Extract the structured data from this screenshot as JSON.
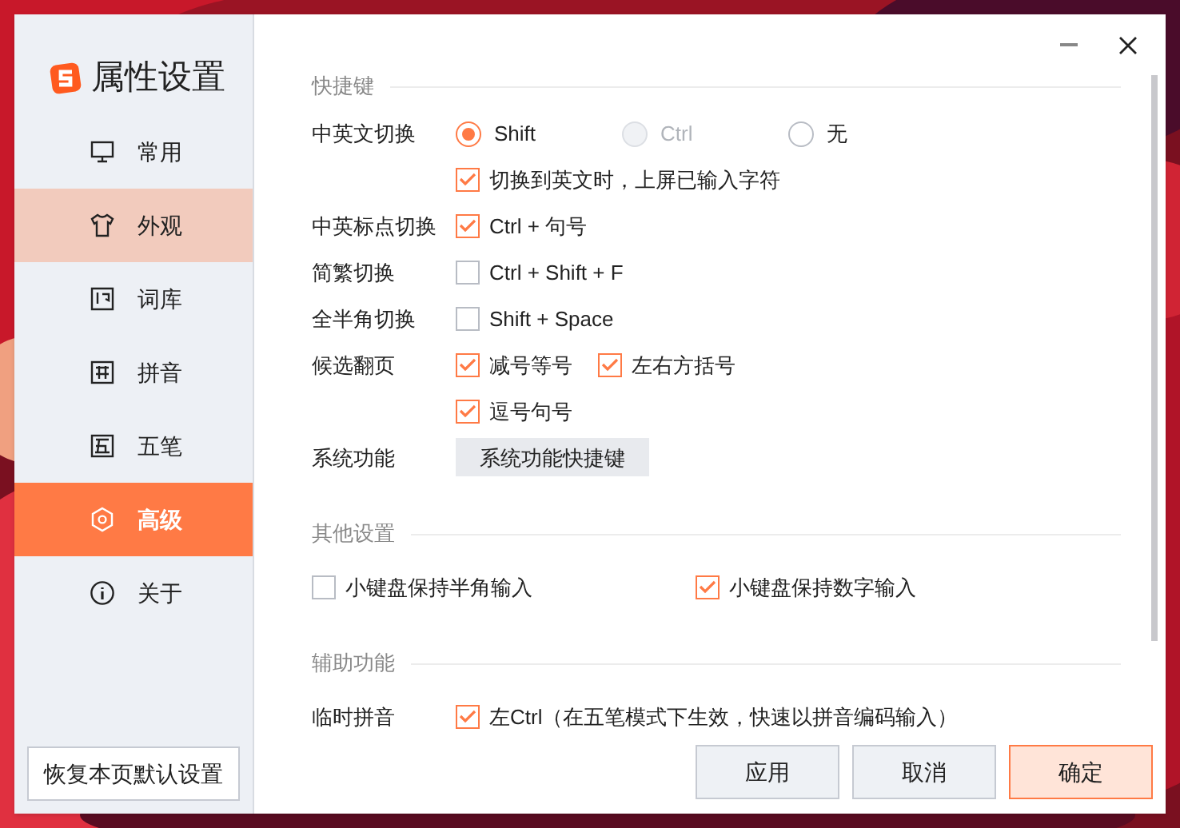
{
  "window": {
    "title": "属性设置"
  },
  "sidebar": {
    "items": [
      {
        "label": "常用",
        "kind": "monitor",
        "selected": false,
        "hovered": false
      },
      {
        "label": "外观",
        "kind": "shirt",
        "selected": false,
        "hovered": true
      },
      {
        "label": "词库",
        "kind": "book",
        "selected": false,
        "hovered": false
      },
      {
        "label": "拼音",
        "kind": "pin",
        "selected": false,
        "hovered": false
      },
      {
        "label": "五笔",
        "kind": "five",
        "selected": false,
        "hovered": false
      },
      {
        "label": "高级",
        "kind": "gear",
        "selected": true,
        "hovered": false
      },
      {
        "label": "关于",
        "kind": "info",
        "selected": false,
        "hovered": false
      }
    ],
    "reset_button": "恢复本页默认设置"
  },
  "sections": [
    {
      "title": "快捷键",
      "rows": [
        {
          "label": "中英文切换",
          "options": [
            {
              "kind": "radio",
              "label": "Shift",
              "selected": true,
              "disabled": false
            },
            {
              "kind": "radio",
              "label": "Ctrl",
              "selected": false,
              "disabled": true
            },
            {
              "kind": "radio",
              "label": "无",
              "selected": false,
              "disabled": false
            }
          ]
        },
        {
          "options": [
            {
              "kind": "checkbox",
              "label": "切换到英文时，上屏已输入字符",
              "checked": true
            }
          ]
        },
        {
          "label": "中英标点切换",
          "options": [
            {
              "kind": "checkbox",
              "label": "Ctrl + 句号",
              "checked": true
            }
          ]
        },
        {
          "label": "简繁切换",
          "options": [
            {
              "kind": "checkbox",
              "label": "Ctrl + Shift + F",
              "checked": false
            }
          ]
        },
        {
          "label": "全半角切换",
          "options": [
            {
              "kind": "checkbox",
              "label": "Shift + Space",
              "checked": false
            }
          ]
        },
        {
          "label": "候选翻页",
          "options": [
            {
              "kind": "checkbox",
              "label": "减号等号",
              "checked": true
            },
            {
              "kind": "checkbox",
              "label": "左右方括号",
              "checked": true
            }
          ]
        },
        {
          "options": [
            {
              "kind": "checkbox",
              "label": "逗号句号",
              "checked": true
            }
          ]
        },
        {
          "label": "系统功能",
          "options": [
            {
              "kind": "button",
              "label": "系统功能快捷键"
            }
          ]
        }
      ]
    },
    {
      "title": "其他设置",
      "rows": [
        {
          "options": [
            {
              "kind": "checkbox",
              "label": "小键盘保持半角输入",
              "checked": false
            },
            {
              "kind": "checkbox",
              "label": "小键盘保持数字输入",
              "checked": true
            }
          ]
        }
      ]
    },
    {
      "title": "辅助功能",
      "rows": [
        {
          "label": "临时拼音",
          "options": [
            {
              "kind": "checkbox",
              "label": "左Ctrl（在五笔模式下生效，快速以拼音编码输入）",
              "checked": true
            }
          ]
        }
      ]
    }
  ],
  "footer": {
    "buttons": [
      {
        "label": "应用",
        "primary": false
      },
      {
        "label": "取消",
        "primary": false
      },
      {
        "label": "确定",
        "primary": true
      }
    ]
  }
}
